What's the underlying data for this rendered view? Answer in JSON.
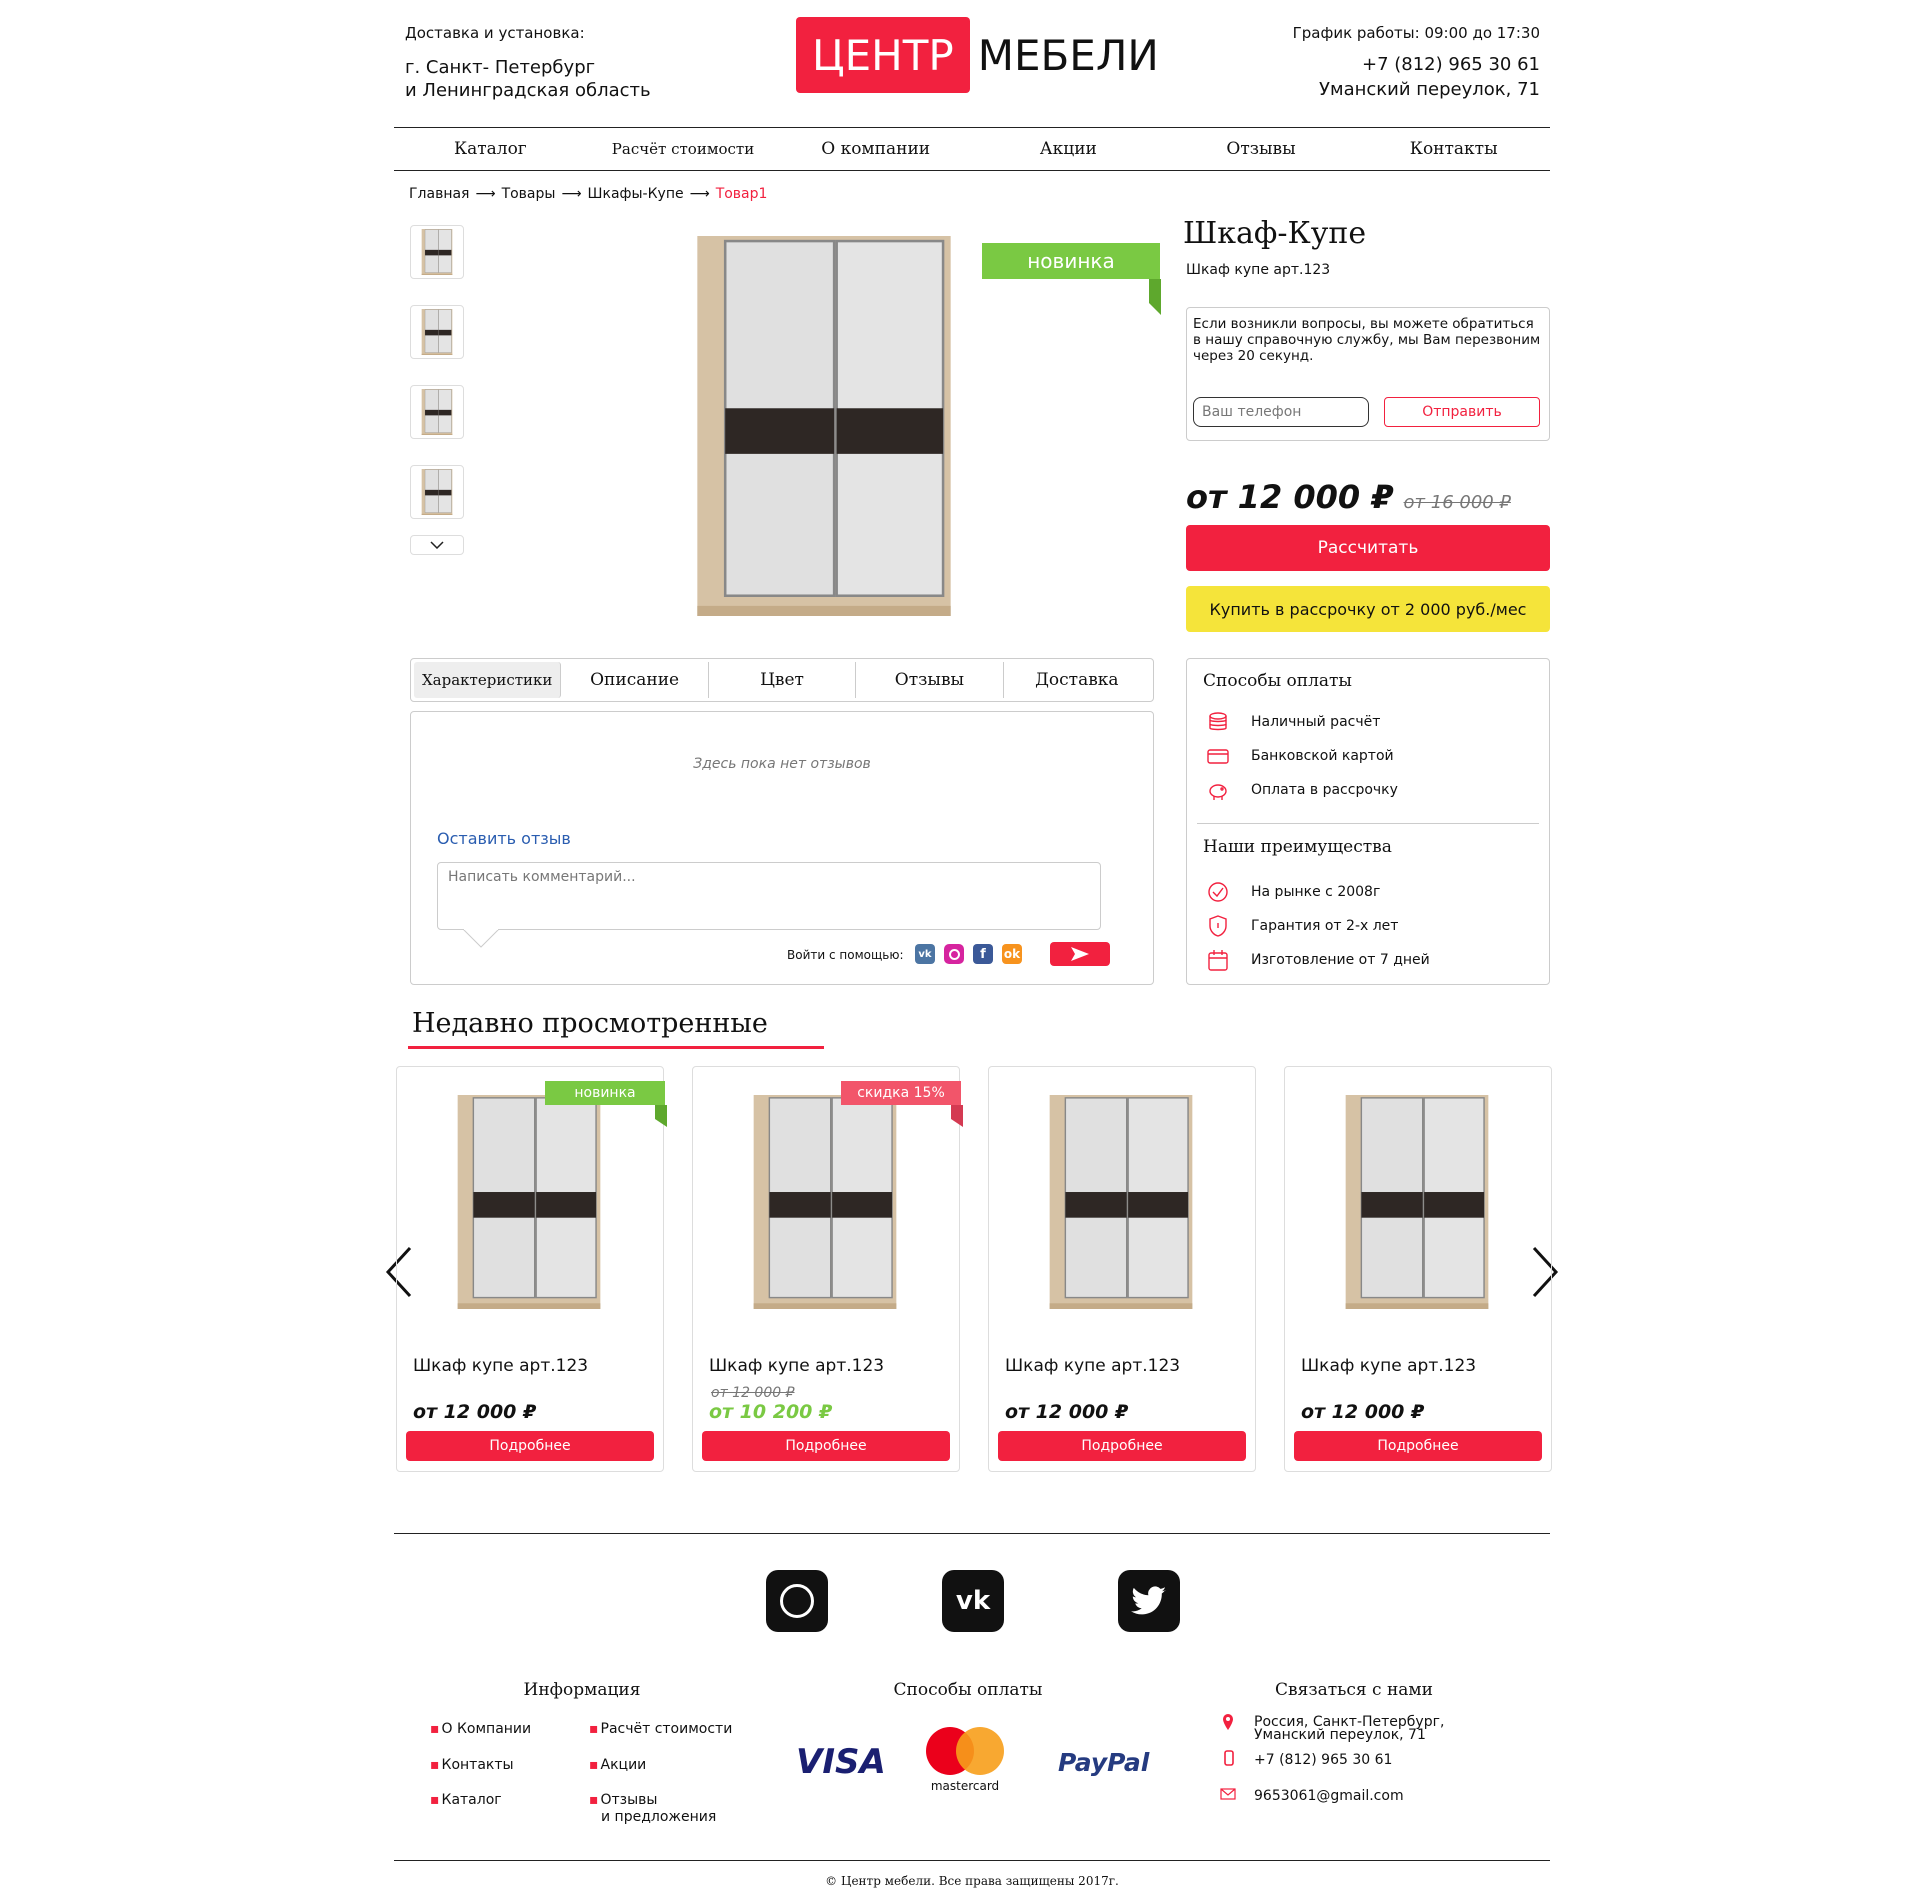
{
  "header": {
    "delivery_label": "Доставка и установка:",
    "city_line1": "г. Санкт- Петербург",
    "city_line2": "и Ленинградская область",
    "logo_red": "ЦЕНТР",
    "logo_black": "МЕБЕЛИ",
    "schedule": "График работы: 09:00 до 17:30",
    "phone": "+7 (812) 965 30 61",
    "address": "Уманский переулок, 71"
  },
  "nav": [
    "Каталог",
    "Расчёт стоимости",
    "О компании",
    "Акции",
    "Отзывы",
    "Контакты"
  ],
  "breadcrumbs": {
    "items": [
      "Главная",
      "Товары",
      "Шкафы-Купе"
    ],
    "current": "Товар1"
  },
  "product": {
    "badge": "новинка",
    "title": "Шкаф-Купе",
    "subtitle": "Шкаф купе арт.123",
    "callback_text": "Если возникли вопросы, вы можете обратиться в нашу справочную службу, мы Вам перезвоним через 20 секунд.",
    "phone_placeholder": "Ваш телефон",
    "send_label": "Отправить",
    "price": "от 12 000 ₽",
    "old_price": "от 16 000 ₽",
    "calc_label": "Рассчитать",
    "installment_label": "Купить в рассрочку от 2 000 руб./мес"
  },
  "tabs": [
    "Характеристики",
    "Описание",
    "Цвет",
    "Отзывы",
    "Доставка"
  ],
  "reviews": {
    "empty": "Здесь пока нет отзывов",
    "leave": "Оставить отзыв",
    "comment_placeholder": "Написать комментарий...",
    "login_with": "Войти с помощью:"
  },
  "sidebar": {
    "payment_title": "Способы оплаты",
    "payments": [
      "Наличный расчёт",
      "Банковской картой",
      "Оплата в рассрочку"
    ],
    "advantages_title": "Наши преимущества",
    "advantages": [
      "На рынке с 2008г",
      "Гарантия от 2-х лет",
      "Изготовление от 7 дней"
    ]
  },
  "recent": {
    "title": "Недавно просмотренные",
    "cards": [
      {
        "badge": "новинка",
        "name": "Шкаф купе арт.123",
        "price": "от 12 000 ₽",
        "old": "",
        "more": "Подробнее"
      },
      {
        "badge": "скидка 15%",
        "name": "Шкаф купе арт.123",
        "price": "от 10 200 ₽",
        "old": "от 12 000 ₽",
        "more": "Подробнее"
      },
      {
        "badge": "",
        "name": "Шкаф купе арт.123",
        "price": "от 12 000 ₽",
        "old": "",
        "more": "Подробнее"
      },
      {
        "badge": "",
        "name": "Шкаф купе арт.123",
        "price": "от 12 000 ₽",
        "old": "",
        "more": "Подробнее"
      }
    ]
  },
  "footer": {
    "info_title": "Информация",
    "info_col1": [
      "О Компании",
      "Контакты",
      "Каталог"
    ],
    "info_col2": [
      "Расчёт стоимости",
      "Акции",
      "Отзывы",
      "и предложения"
    ],
    "pay_title": "Способы оплаты",
    "visa": "VISA",
    "mastercard": "mastercard",
    "paypal": "PayPal",
    "contact_title": "Связаться с нами",
    "address1": "Россия, Санкт-Петербург,",
    "address2": "Уманский переулок, 71",
    "phone": "+7 (812) 965 30 61",
    "email": "9653061@gmail.com",
    "copyright": "© Центр мебели. Все права защищены 2017г."
  },
  "colors": {
    "accent": "#f2213f",
    "new_badge": "#7ac943",
    "sale_badge": "#f2556a",
    "yellow": "#f5e43a"
  }
}
